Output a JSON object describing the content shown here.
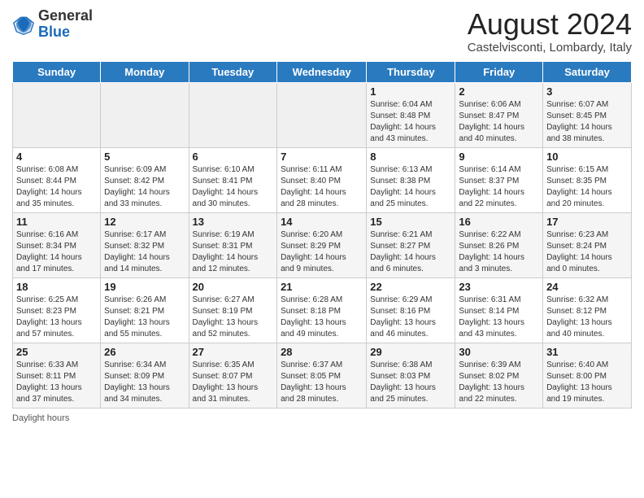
{
  "header": {
    "logo_general": "General",
    "logo_blue": "Blue",
    "month_year": "August 2024",
    "location": "Castelvisconti, Lombardy, Italy"
  },
  "footer": {
    "daylight_label": "Daylight hours"
  },
  "days_of_week": [
    "Sunday",
    "Monday",
    "Tuesday",
    "Wednesday",
    "Thursday",
    "Friday",
    "Saturday"
  ],
  "weeks": [
    [
      {
        "num": "",
        "info": ""
      },
      {
        "num": "",
        "info": ""
      },
      {
        "num": "",
        "info": ""
      },
      {
        "num": "",
        "info": ""
      },
      {
        "num": "1",
        "info": "Sunrise: 6:04 AM\nSunset: 8:48 PM\nDaylight: 14 hours\nand 43 minutes."
      },
      {
        "num": "2",
        "info": "Sunrise: 6:06 AM\nSunset: 8:47 PM\nDaylight: 14 hours\nand 40 minutes."
      },
      {
        "num": "3",
        "info": "Sunrise: 6:07 AM\nSunset: 8:45 PM\nDaylight: 14 hours\nand 38 minutes."
      }
    ],
    [
      {
        "num": "4",
        "info": "Sunrise: 6:08 AM\nSunset: 8:44 PM\nDaylight: 14 hours\nand 35 minutes."
      },
      {
        "num": "5",
        "info": "Sunrise: 6:09 AM\nSunset: 8:42 PM\nDaylight: 14 hours\nand 33 minutes."
      },
      {
        "num": "6",
        "info": "Sunrise: 6:10 AM\nSunset: 8:41 PM\nDaylight: 14 hours\nand 30 minutes."
      },
      {
        "num": "7",
        "info": "Sunrise: 6:11 AM\nSunset: 8:40 PM\nDaylight: 14 hours\nand 28 minutes."
      },
      {
        "num": "8",
        "info": "Sunrise: 6:13 AM\nSunset: 8:38 PM\nDaylight: 14 hours\nand 25 minutes."
      },
      {
        "num": "9",
        "info": "Sunrise: 6:14 AM\nSunset: 8:37 PM\nDaylight: 14 hours\nand 22 minutes."
      },
      {
        "num": "10",
        "info": "Sunrise: 6:15 AM\nSunset: 8:35 PM\nDaylight: 14 hours\nand 20 minutes."
      }
    ],
    [
      {
        "num": "11",
        "info": "Sunrise: 6:16 AM\nSunset: 8:34 PM\nDaylight: 14 hours\nand 17 minutes."
      },
      {
        "num": "12",
        "info": "Sunrise: 6:17 AM\nSunset: 8:32 PM\nDaylight: 14 hours\nand 14 minutes."
      },
      {
        "num": "13",
        "info": "Sunrise: 6:19 AM\nSunset: 8:31 PM\nDaylight: 14 hours\nand 12 minutes."
      },
      {
        "num": "14",
        "info": "Sunrise: 6:20 AM\nSunset: 8:29 PM\nDaylight: 14 hours\nand 9 minutes."
      },
      {
        "num": "15",
        "info": "Sunrise: 6:21 AM\nSunset: 8:27 PM\nDaylight: 14 hours\nand 6 minutes."
      },
      {
        "num": "16",
        "info": "Sunrise: 6:22 AM\nSunset: 8:26 PM\nDaylight: 14 hours\nand 3 minutes."
      },
      {
        "num": "17",
        "info": "Sunrise: 6:23 AM\nSunset: 8:24 PM\nDaylight: 14 hours\nand 0 minutes."
      }
    ],
    [
      {
        "num": "18",
        "info": "Sunrise: 6:25 AM\nSunset: 8:23 PM\nDaylight: 13 hours\nand 57 minutes."
      },
      {
        "num": "19",
        "info": "Sunrise: 6:26 AM\nSunset: 8:21 PM\nDaylight: 13 hours\nand 55 minutes."
      },
      {
        "num": "20",
        "info": "Sunrise: 6:27 AM\nSunset: 8:19 PM\nDaylight: 13 hours\nand 52 minutes."
      },
      {
        "num": "21",
        "info": "Sunrise: 6:28 AM\nSunset: 8:18 PM\nDaylight: 13 hours\nand 49 minutes."
      },
      {
        "num": "22",
        "info": "Sunrise: 6:29 AM\nSunset: 8:16 PM\nDaylight: 13 hours\nand 46 minutes."
      },
      {
        "num": "23",
        "info": "Sunrise: 6:31 AM\nSunset: 8:14 PM\nDaylight: 13 hours\nand 43 minutes."
      },
      {
        "num": "24",
        "info": "Sunrise: 6:32 AM\nSunset: 8:12 PM\nDaylight: 13 hours\nand 40 minutes."
      }
    ],
    [
      {
        "num": "25",
        "info": "Sunrise: 6:33 AM\nSunset: 8:11 PM\nDaylight: 13 hours\nand 37 minutes."
      },
      {
        "num": "26",
        "info": "Sunrise: 6:34 AM\nSunset: 8:09 PM\nDaylight: 13 hours\nand 34 minutes."
      },
      {
        "num": "27",
        "info": "Sunrise: 6:35 AM\nSunset: 8:07 PM\nDaylight: 13 hours\nand 31 minutes."
      },
      {
        "num": "28",
        "info": "Sunrise: 6:37 AM\nSunset: 8:05 PM\nDaylight: 13 hours\nand 28 minutes."
      },
      {
        "num": "29",
        "info": "Sunrise: 6:38 AM\nSunset: 8:03 PM\nDaylight: 13 hours\nand 25 minutes."
      },
      {
        "num": "30",
        "info": "Sunrise: 6:39 AM\nSunset: 8:02 PM\nDaylight: 13 hours\nand 22 minutes."
      },
      {
        "num": "31",
        "info": "Sunrise: 6:40 AM\nSunset: 8:00 PM\nDaylight: 13 hours\nand 19 minutes."
      }
    ]
  ]
}
